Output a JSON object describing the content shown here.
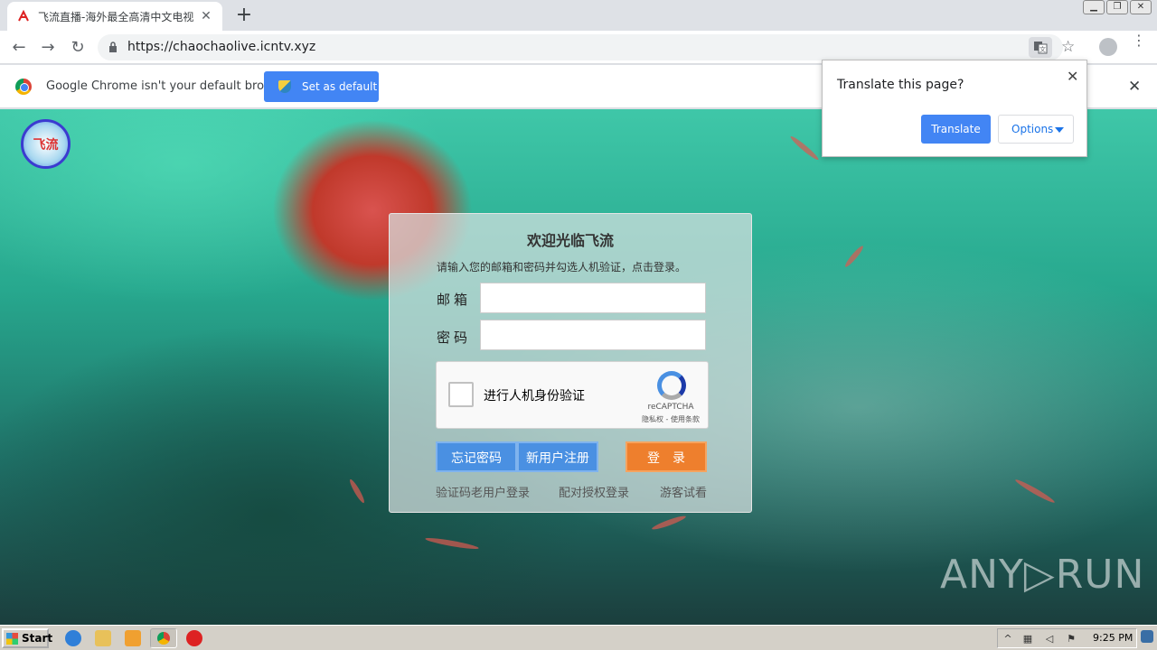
{
  "browser": {
    "tab_title": "飞流直播-海外最全高清中文电视直播",
    "tab_close": "✕",
    "new_tab": "+",
    "url": "https://chaochaolive.icntv.xyz",
    "nav": {
      "back": "←",
      "forward": "→",
      "reload": "↻"
    },
    "bookmark": "☆",
    "menu": "⋮",
    "window_controls": [
      "▁",
      "❐",
      "✕"
    ]
  },
  "infobar": {
    "message": "Google Chrome isn't your default browser",
    "button": "Set as default",
    "close": "✕"
  },
  "translate_bubble": {
    "question": "Translate this page?",
    "translate_button": "Translate",
    "options_button": "Options",
    "close": "✕"
  },
  "login": {
    "title": "欢迎光临飞流",
    "subtitle": "请输入您的邮箱和密码并勾选人机验证，点击登录。",
    "email_label": "邮箱",
    "password_label": "密码",
    "email_value": "",
    "password_value": "",
    "captcha_text": "进行人机身份验证",
    "captcha_brand": "reCAPTCHA",
    "captcha_links": "隐私权 - 使用条款",
    "forgot_button": "忘记密码",
    "register_button": "新用户注册",
    "login_button": "登录",
    "links": [
      "验证码老用户登录",
      "配对授权登录",
      "游客试看"
    ]
  },
  "watermark": "ANY▷RUN",
  "logo_text": "飞流",
  "taskbar": {
    "start": "Start",
    "time": "9:25 PM"
  },
  "colors": {
    "accent": "#4285f4",
    "login_orange": "#ee7f2d",
    "login_blue": "#4a90e2"
  }
}
